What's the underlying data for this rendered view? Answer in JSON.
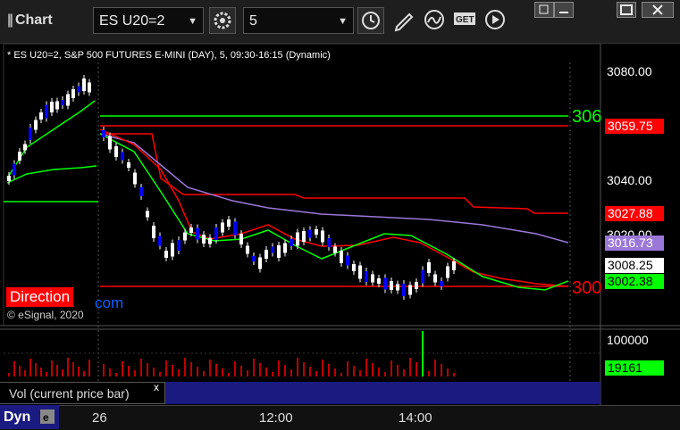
{
  "window": {
    "title": "Chart",
    "title_glyph": "||"
  },
  "toolbar": {
    "symbol": "ES U20=2",
    "interval": "5"
  },
  "chart_info": "* ES U20=2, S&P 500 FUTURES E-MINI (DAY), 5, 09:30-16:15 (Dynamic)",
  "price_axis": [
    "3080.00",
    "3040.00",
    "3020.00"
  ],
  "tags": {
    "red_upper": "3059.75",
    "red_mid": "3027.88",
    "purple": "3016.73",
    "last": "3008.25",
    "green": "3002.38"
  },
  "line_labels": {
    "green": "306",
    "red": "300"
  },
  "overlay": {
    "direction": "Direction",
    "com_fragment": "com"
  },
  "copyright": "© eSignal, 2020",
  "volume": {
    "axis_label": "100000",
    "tag": "19161",
    "panel_label": "Vol (current price bar)",
    "close_glyph": "x"
  },
  "bottom": {
    "dyn": "Dyn",
    "times": [
      "26",
      "12:00",
      "14:00"
    ]
  },
  "colors": {
    "green_line": "#00ff00",
    "red_line": "#ff0000",
    "purple_ma": "#9b78d8",
    "up_candle": "#ffffff",
    "down_candle": "#0000ff",
    "volume_bar": "#c00000"
  }
}
